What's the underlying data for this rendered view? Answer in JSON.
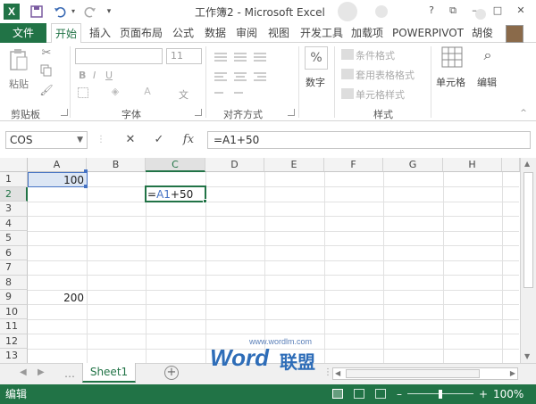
{
  "title": {
    "text": "工作簿2 - Microsoft Excel"
  },
  "qat": {
    "save_icon": "save-icon",
    "undo_icon": "undo-icon",
    "redo_icon": "redo-icon"
  },
  "window": {
    "help": "?",
    "restore": "⧉",
    "min": "–",
    "max": "□",
    "close": "✕"
  },
  "tabs": {
    "file": "文件",
    "home": "开始",
    "insert": "插入",
    "layout": "页面布局",
    "formulas": "公式",
    "data": "数据",
    "review": "审阅",
    "view": "视图",
    "dev": "开发工具",
    "addins": "加载项",
    "powerpivot": "POWERPIVOT",
    "user": "胡俊"
  },
  "ribbon": {
    "clipboard": {
      "paste": "粘贴",
      "label": "剪贴板"
    },
    "font": {
      "size": "11",
      "label": "字体",
      "wen": "文"
    },
    "align": {
      "label": "对齐方式"
    },
    "number": {
      "btn": "数字",
      "pct": "%"
    },
    "styles": {
      "cond": "条件格式",
      "table": "套用表格格式",
      "cell": "单元格样式",
      "label": "样式"
    },
    "cells": {
      "btn": "单元格"
    },
    "editing": {
      "btn": "编辑"
    }
  },
  "formula_bar": {
    "namebox": "COS",
    "cancel": "✕",
    "enter": "✓",
    "fx": "fx",
    "formula": "=A1+50"
  },
  "grid": {
    "columns": [
      "A",
      "B",
      "C",
      "D",
      "E",
      "F",
      "G",
      "H"
    ],
    "rows": [
      "1",
      "2",
      "3",
      "4",
      "5",
      "6",
      "7",
      "8",
      "9",
      "10",
      "11",
      "12",
      "13"
    ],
    "a1": "100",
    "a9": "200",
    "c2_eq": "=",
    "c2_ref": "A1",
    "c2_rest": "+50"
  },
  "sheet_tabs": {
    "sheet1": "Sheet1",
    "add": "+"
  },
  "status": {
    "mode": "编辑",
    "zoom": "100%",
    "minus": "–",
    "plus": "+"
  },
  "watermark": {
    "url": "www.wordlm.com",
    "brand": "Word",
    "brand_cn": "联盟"
  }
}
